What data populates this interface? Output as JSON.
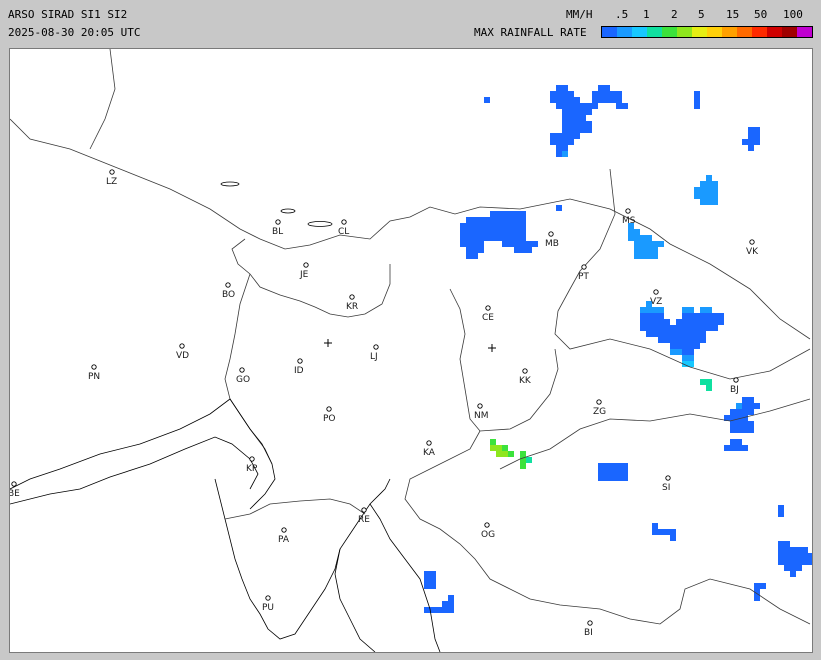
{
  "header": {
    "title": "ARSO SIRAD SI1 SI2",
    "datetime": "2025-08-30 20:05 UTC",
    "units": "MM/H",
    "legend_title": "MAX RAINFALL RATE",
    "scale_labels": [
      ".5",
      "1",
      "2",
      "5",
      "15",
      "50",
      "100"
    ],
    "scale_colors": [
      "#1a66ff",
      "#1a9aff",
      "#18c8ff",
      "#10e0a0",
      "#3ce23c",
      "#8ee61e",
      "#e6ee14",
      "#ffd00a",
      "#ffa000",
      "#ff6a00",
      "#ff2a00",
      "#d00000",
      "#a00000",
      "#c000d0"
    ]
  },
  "map": {
    "colors": {
      "coast": "#000000",
      "border": "#3a3a3a",
      "marker": "#000000"
    },
    "places": [
      {
        "label": "LZ"
      },
      {
        "label": "BL"
      },
      {
        "label": "CL"
      },
      {
        "label": "JE"
      },
      {
        "label": "BO"
      },
      {
        "label": "KR"
      },
      {
        "label": "VD"
      },
      {
        "label": "LJ"
      },
      {
        "label": "ID"
      },
      {
        "label": "PN"
      },
      {
        "label": "GO"
      },
      {
        "label": "PO"
      },
      {
        "label": "KP"
      },
      {
        "label": "BE"
      },
      {
        "label": "PA"
      },
      {
        "label": "RE"
      },
      {
        "label": "PU"
      },
      {
        "label": "MS"
      },
      {
        "label": "MB"
      },
      {
        "label": "VK"
      },
      {
        "label": "PT"
      },
      {
        "label": "VZ"
      },
      {
        "label": "CE"
      },
      {
        "label": "KK"
      },
      {
        "label": "NM"
      },
      {
        "label": "ZG"
      },
      {
        "label": "BJ"
      },
      {
        "label": "KA"
      },
      {
        "label": "OG"
      },
      {
        "label": "SI"
      },
      {
        "label": "BI"
      }
    ]
  }
}
